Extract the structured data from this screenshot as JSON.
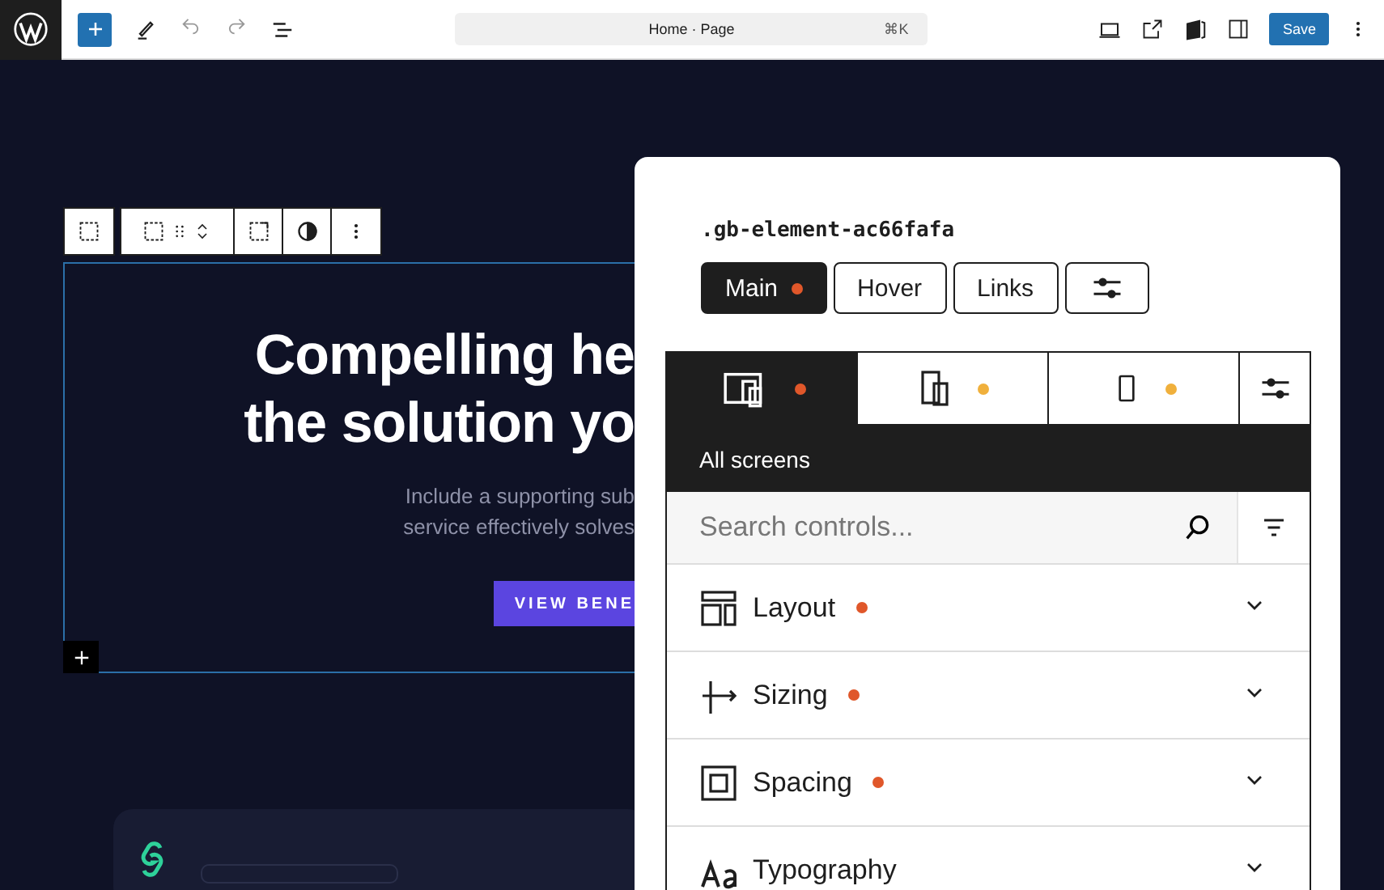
{
  "top_bar": {
    "command_bar": {
      "title": "Home · Page",
      "shortcut": "⌘K"
    },
    "save_label": "Save"
  },
  "canvas": {
    "heading_lines": [
      "Compelling he",
      "the solution yo"
    ],
    "subtitle_lines": [
      "Include a supporting sub",
      "service effectively solves"
    ],
    "cta": "VIEW BENE"
  },
  "panel": {
    "selector": ".gb-element-ac66fafa",
    "state_tabs": [
      {
        "label": "Main",
        "selected": true,
        "modified": true
      },
      {
        "label": "Hover",
        "selected": false,
        "modified": false
      },
      {
        "label": "Links",
        "selected": false,
        "modified": false
      }
    ],
    "device_tabs": [
      {
        "kind": "all",
        "selected": true,
        "color": "#e0572a"
      },
      {
        "kind": "tablet",
        "selected": false,
        "color": "#f0b03c"
      },
      {
        "kind": "mobile",
        "selected": false,
        "color": "#f0b03c"
      }
    ],
    "device_label": "All screens",
    "search": {
      "placeholder": "Search controls..."
    },
    "sections": [
      {
        "kind": "layout",
        "label": "Layout",
        "modified": true,
        "expanded": false
      },
      {
        "kind": "sizing",
        "label": "Sizing",
        "modified": true,
        "expanded": false
      },
      {
        "kind": "spacing",
        "label": "Spacing",
        "modified": true,
        "expanded": false
      },
      {
        "kind": "typography",
        "label": "Typography",
        "modified": false,
        "expanded": false
      }
    ]
  }
}
